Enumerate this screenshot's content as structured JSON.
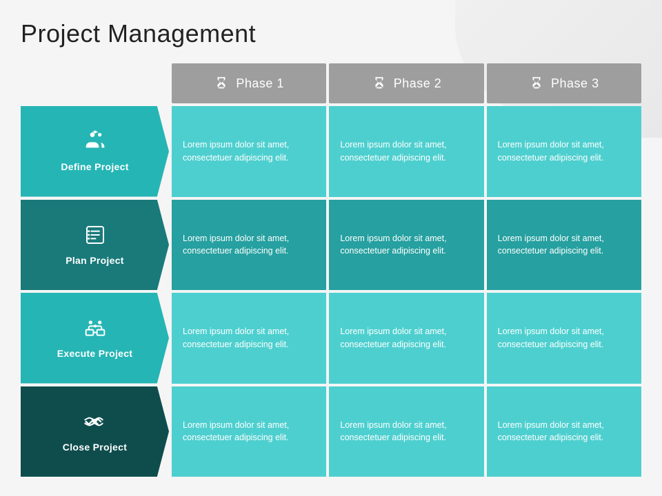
{
  "title": "Project Management",
  "phases": [
    {
      "id": "phase1",
      "label": "Phase 1"
    },
    {
      "id": "phase2",
      "label": "Phase 2"
    },
    {
      "id": "phase3",
      "label": "Phase 3"
    }
  ],
  "rows": [
    {
      "id": "define",
      "label": "Define Project",
      "icon": "people-icon",
      "colorClass": "row-label-0",
      "cells": [
        {
          "text": "Lorem ipsum dolor sit amet, consectetuer adipiscing elit."
        },
        {
          "text": "Lorem ipsum dolor sit amet, consectetuer adipiscing elit."
        },
        {
          "text": "Lorem ipsum dolor sit amet, consectetuer adipiscing elit."
        }
      ]
    },
    {
      "id": "plan",
      "label": "Plan Project",
      "icon": "list-icon",
      "colorClass": "row-label-1",
      "cells": [
        {
          "text": "Lorem ipsum dolor sit amet, consectetuer adipiscing elit."
        },
        {
          "text": "Lorem ipsum dolor sit amet, consectetuer adipiscing elit."
        },
        {
          "text": "Lorem ipsum dolor sit amet, consectetuer adipiscing elit."
        }
      ]
    },
    {
      "id": "execute",
      "label": "Execute Project",
      "icon": "meeting-icon",
      "colorClass": "row-label-2",
      "cells": [
        {
          "text": "Lorem ipsum dolor sit amet, consectetuer adipiscing elit."
        },
        {
          "text": "Lorem ipsum dolor sit amet, consectetuer adipiscing elit."
        },
        {
          "text": "Lorem ipsum dolor sit amet, consectetuer adipiscing elit."
        }
      ]
    },
    {
      "id": "close",
      "label": "Close Project",
      "icon": "handshake-icon",
      "colorClass": "row-label-3",
      "cells": [
        {
          "text": "Lorem ipsum dolor sit amet, consectetuer adipiscing elit."
        },
        {
          "text": "Lorem ipsum dolor sit amet, consectetuer adipiscing elit."
        },
        {
          "text": "Lorem ipsum dolor sit amet, consectetuer adipiscing elit."
        }
      ]
    }
  ],
  "lorem": "Lorem ipsum dolor sit amet, consectetuer adipiscing elit."
}
